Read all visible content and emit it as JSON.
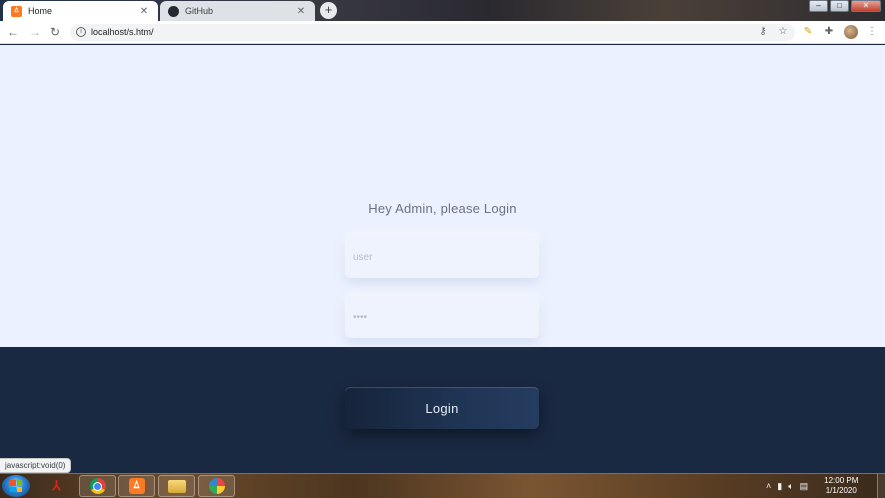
{
  "browser": {
    "tabs": [
      {
        "title": "Home",
        "icon": "xampp-icon",
        "active": true
      },
      {
        "title": "GitHub",
        "icon": "github-icon",
        "active": false
      }
    ],
    "new_tab_symbol": "+",
    "url": "localhost/s.htm/"
  },
  "page": {
    "heading": "Hey Admin, please Login",
    "username": {
      "placeholder": "user",
      "value": ""
    },
    "password": {
      "placeholder": "••••",
      "value": ""
    },
    "login_label": "Login",
    "status_text": "javascript:void(0)",
    "colors": {
      "top_background": "#ebf1fe",
      "bottom_background": "#1a2942",
      "button": "#1f3555"
    }
  },
  "taskbar": {
    "apps": [
      "Adobe Acrobat",
      "Google Chrome",
      "XAMPP",
      "File Explorer",
      "Paint"
    ],
    "clock": {
      "time": "12:00 PM",
      "date": "1/1/2020"
    }
  }
}
